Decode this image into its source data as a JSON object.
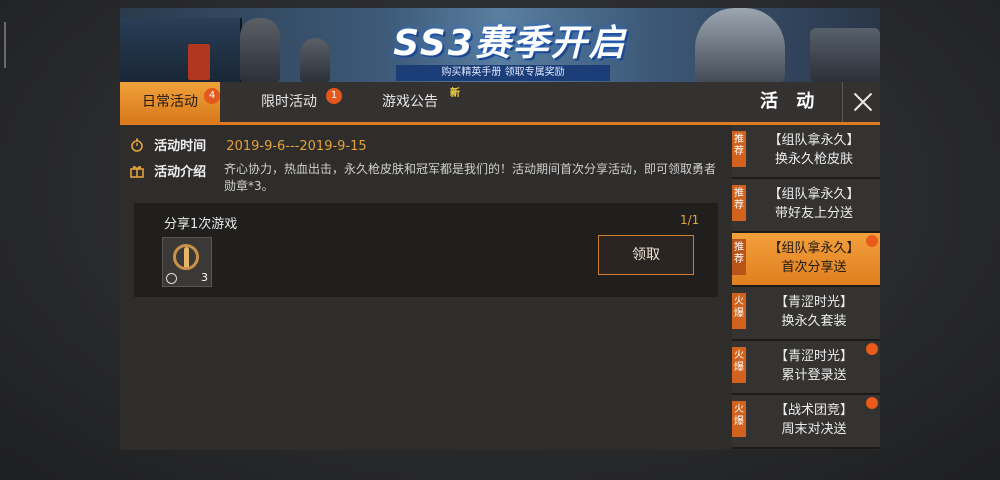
{
  "banner": {
    "title": "SS3赛季开启",
    "subtitle": "购买精英手册   领取专属奖励"
  },
  "tabs": [
    {
      "label": "日常活动",
      "badge": "4"
    },
    {
      "label": "限时活动",
      "badge": "1"
    },
    {
      "label": "游戏公告",
      "tag": "新"
    }
  ],
  "panel_title": "活 动",
  "content": {
    "time_label": "活动时间",
    "time_value": "2019-9-6---2019-9-15",
    "intro_label": "活动介绍",
    "intro_text": "齐心协力，热血出击，永久枪皮肤和冠军都是我们的！活动期间首次分享活动，即可领取勇者勋章*3。",
    "task": {
      "title": "分享1次游戏",
      "progress": "1/1",
      "reward_count": "3",
      "claim_label": "领取"
    }
  },
  "side_items": [
    {
      "tag": "推荐",
      "line1": "【组队拿永久】",
      "line2": "换永久枪皮肤",
      "dot": false,
      "active": false
    },
    {
      "tag": "推荐",
      "line1": "【组队拿永久】",
      "line2": "带好友上分送",
      "dot": false,
      "active": false
    },
    {
      "tag": "推荐",
      "line1": "【组队拿永久】",
      "line2": "首次分享送",
      "dot": true,
      "active": true
    },
    {
      "tag": "火爆",
      "line1": "【青涩时光】",
      "line2": "换永久套装",
      "dot": false,
      "active": false
    },
    {
      "tag": "火爆",
      "line1": "【青涩时光】",
      "line2": "累计登录送",
      "dot": true,
      "active": false
    },
    {
      "tag": "火爆",
      "line1": "【战术团竞】",
      "line2": "周末对决送",
      "dot": true,
      "active": false
    }
  ],
  "colors": {
    "accent": "#e07a1f",
    "badge": "#e4581c",
    "time": "#e3a23b"
  }
}
